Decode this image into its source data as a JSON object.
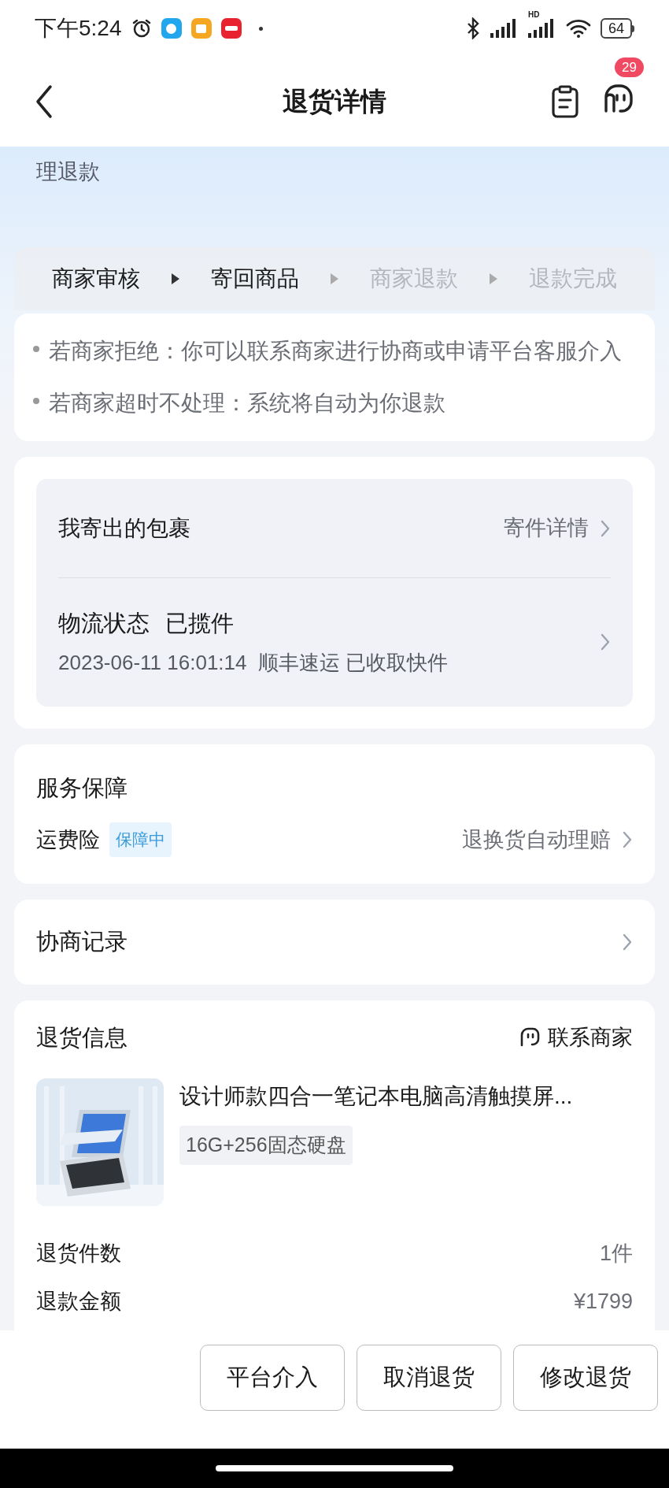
{
  "status_bar": {
    "time": "下午5:24",
    "network_label": "HD",
    "battery": "64"
  },
  "header": {
    "title": "退货详情",
    "message_badge": "29"
  },
  "banner": {
    "text": "理退款"
  },
  "steps": [
    {
      "label": "商家审核",
      "done": true
    },
    {
      "label": "寄回商品",
      "done": true
    },
    {
      "label": "商家退款",
      "done": false
    },
    {
      "label": "退款完成",
      "done": false
    }
  ],
  "notes": [
    "若商家拒绝：你可以联系商家进行协商或申请平台客服介入",
    "若商家超时不处理：系统将自动为你退款"
  ],
  "package": {
    "title": "我寄出的包裹",
    "link": "寄件详情",
    "status_label": "物流状态",
    "status": "已揽件",
    "detail": "2023-06-11 16:01:14  顺丰速运 已收取快件"
  },
  "service": {
    "title": "服务保障",
    "item": "运费险",
    "tag": "保障中",
    "link": "退换货自动理赔"
  },
  "negotiation": {
    "title": "协商记录"
  },
  "return_info": {
    "title": "退货信息",
    "contact": "联系商家",
    "product": {
      "name": "设计师款四合一笔记本电脑高清触摸屏...",
      "spec": "16G+256固态硬盘"
    },
    "rows": [
      {
        "label": "退货件数",
        "value": "1件"
      },
      {
        "label": "退款金额",
        "value": "¥1799"
      }
    ]
  },
  "actions": [
    "平台介入",
    "取消退货",
    "修改退货"
  ]
}
